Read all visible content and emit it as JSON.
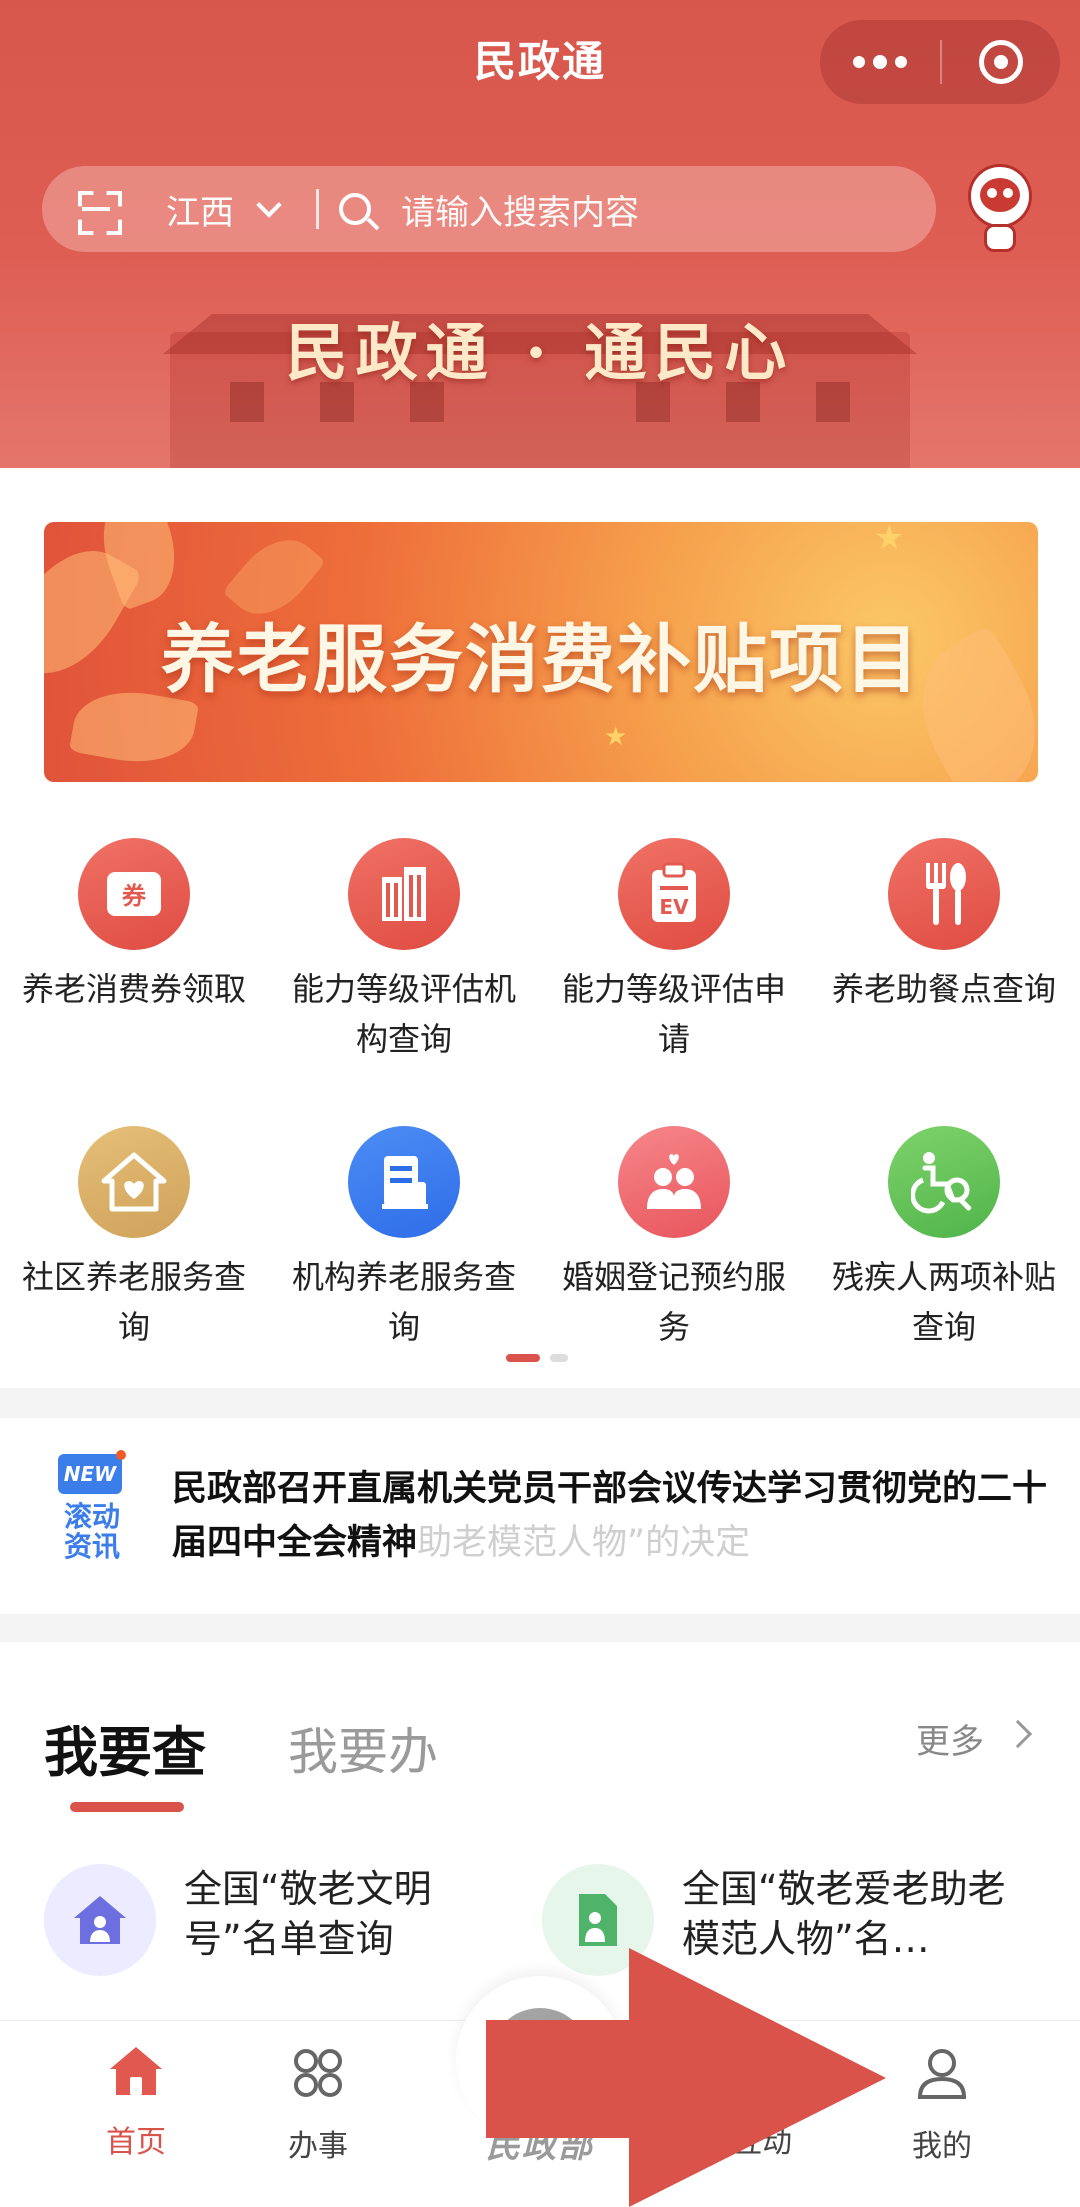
{
  "header": {
    "app_title": "民政通",
    "region": "江西",
    "search_placeholder": "请输入搜索内容",
    "slogan": "民政通 · 通民心"
  },
  "banner": {
    "text": "养老服务消费补贴项目"
  },
  "services": [
    {
      "label": "养老消费券领取",
      "icon": "coupon-icon",
      "color": "#e85a4f"
    },
    {
      "label": "能力等级评估机构查询",
      "icon": "building-icon",
      "color": "#e85a4f"
    },
    {
      "label": "能力等级评估申请",
      "icon": "clipboard-icon",
      "color": "#e85a4f"
    },
    {
      "label": "养老助餐点查询",
      "icon": "fork-spoon-icon",
      "color": "#e85a4f"
    },
    {
      "label": "社区养老服务查询",
      "icon": "home-heart-icon",
      "color": "#d4aa63"
    },
    {
      "label": "机构养老服务查询",
      "icon": "document-icon",
      "color": "#3575ea"
    },
    {
      "label": "婚姻登记预约服务",
      "icon": "couple-icon",
      "color": "#ee6a6e"
    },
    {
      "label": "残疾人两项补贴查询",
      "icon": "wheelchair-icon",
      "color": "#5cbf55"
    }
  ],
  "pager": {
    "pages": 2,
    "current": 1
  },
  "news": {
    "badge": "NEW",
    "label": "滚动资讯",
    "headline": "民政部召开直属机关党员干部会议传达学习贯彻党的二十届四中全会精神",
    "ghost": "助老模范人物”的决定"
  },
  "query": {
    "tab_active": "我要查",
    "tab_other": "我要办",
    "more": "更多",
    "items": [
      {
        "label": "全国“敬老文明号”名单查询",
        "icon": "elder-home-icon"
      },
      {
        "label": "全国“敬老爱老助老模范人物”名…",
        "icon": "elder-doc-icon"
      }
    ]
  },
  "tabbar": {
    "home": "首页",
    "services": "办事",
    "center": "民政部",
    "interact": "互动",
    "mine": "我的"
  },
  "colors": {
    "brand": "#d9534a",
    "header": "#de5e54",
    "arrow": "#d9534a"
  }
}
